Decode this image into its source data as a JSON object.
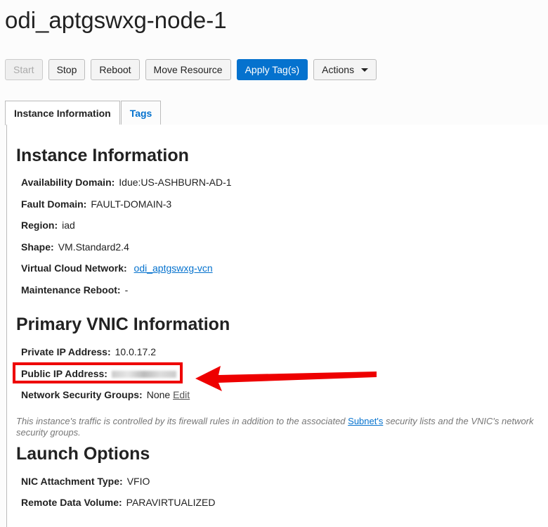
{
  "title": "odi_aptgswxg-node-1",
  "toolbar": {
    "start": "Start",
    "stop": "Stop",
    "reboot": "Reboot",
    "move": "Move Resource",
    "apply_tags": "Apply Tag(s)",
    "actions": "Actions"
  },
  "tabs": {
    "instance": "Instance Information",
    "tags": "Tags"
  },
  "instance": {
    "heading": "Instance Information",
    "availability_domain_label": "Availability Domain:",
    "availability_domain": "Idue:US-ASHBURN-AD-1",
    "fault_domain_label": "Fault Domain:",
    "fault_domain": "FAULT-DOMAIN-3",
    "region_label": "Region:",
    "region": "iad",
    "shape_label": "Shape:",
    "shape": "VM.Standard2.4",
    "vcn_label": "Virtual Cloud Network:",
    "vcn": "odi_aptgswxg-vcn",
    "maintenance_label": "Maintenance Reboot:",
    "maintenance": "-"
  },
  "vnic": {
    "heading": "Primary VNIC Information",
    "private_ip_label": "Private IP Address:",
    "private_ip": "10.0.17.2",
    "public_ip_label": "Public IP Address:",
    "nsg_label": "Network Security Groups:",
    "nsg": "None",
    "nsg_edit": "Edit",
    "note_pre": "This instance's traffic is controlled by its firewall rules in addition to the associated ",
    "note_link": "Subnet's",
    "note_post": " security lists and the VNIC's network security groups."
  },
  "launch": {
    "heading": "Launch Options",
    "nic_label": "NIC Attachment Type:",
    "nic": "VFIO",
    "rdv_label": "Remote Data Volume:",
    "rdv": "PARAVIRTUALIZED"
  },
  "colors": {
    "primary": "#0572ce",
    "highlight": "#e00000"
  }
}
